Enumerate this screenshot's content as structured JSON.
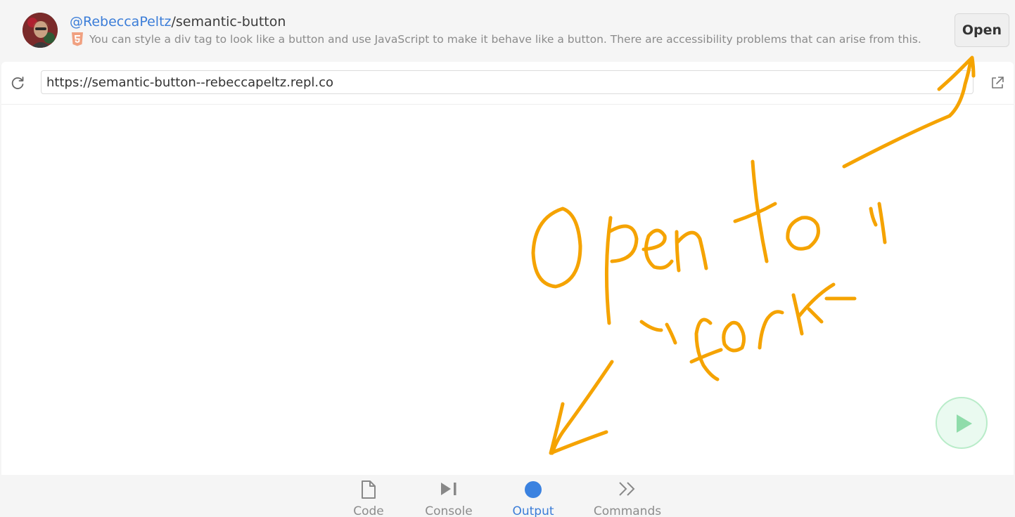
{
  "header": {
    "owner_link": "@RebeccaPeltz",
    "separator": "/",
    "repl_name": "semantic-button",
    "description": "You can style a div tag to look like a button and use JavaScript to make it behave like a button. There are accessibility problems that can arise from this.",
    "open_label": "Open"
  },
  "webview": {
    "url": "https://semantic-button--rebeccapeltz.repl.co"
  },
  "tabs": [
    {
      "label": "Code",
      "icon": "file-icon",
      "active": false
    },
    {
      "label": "Console",
      "icon": "play-console-icon",
      "active": false
    },
    {
      "label": "Output",
      "icon": "output-dot-icon",
      "active": true
    },
    {
      "label": "Commands",
      "icon": "chevrons-icon",
      "active": false
    }
  ],
  "colors": {
    "link": "#3b7dd8",
    "annotation": "#f5a300",
    "run_button": "#8fdcaa"
  }
}
